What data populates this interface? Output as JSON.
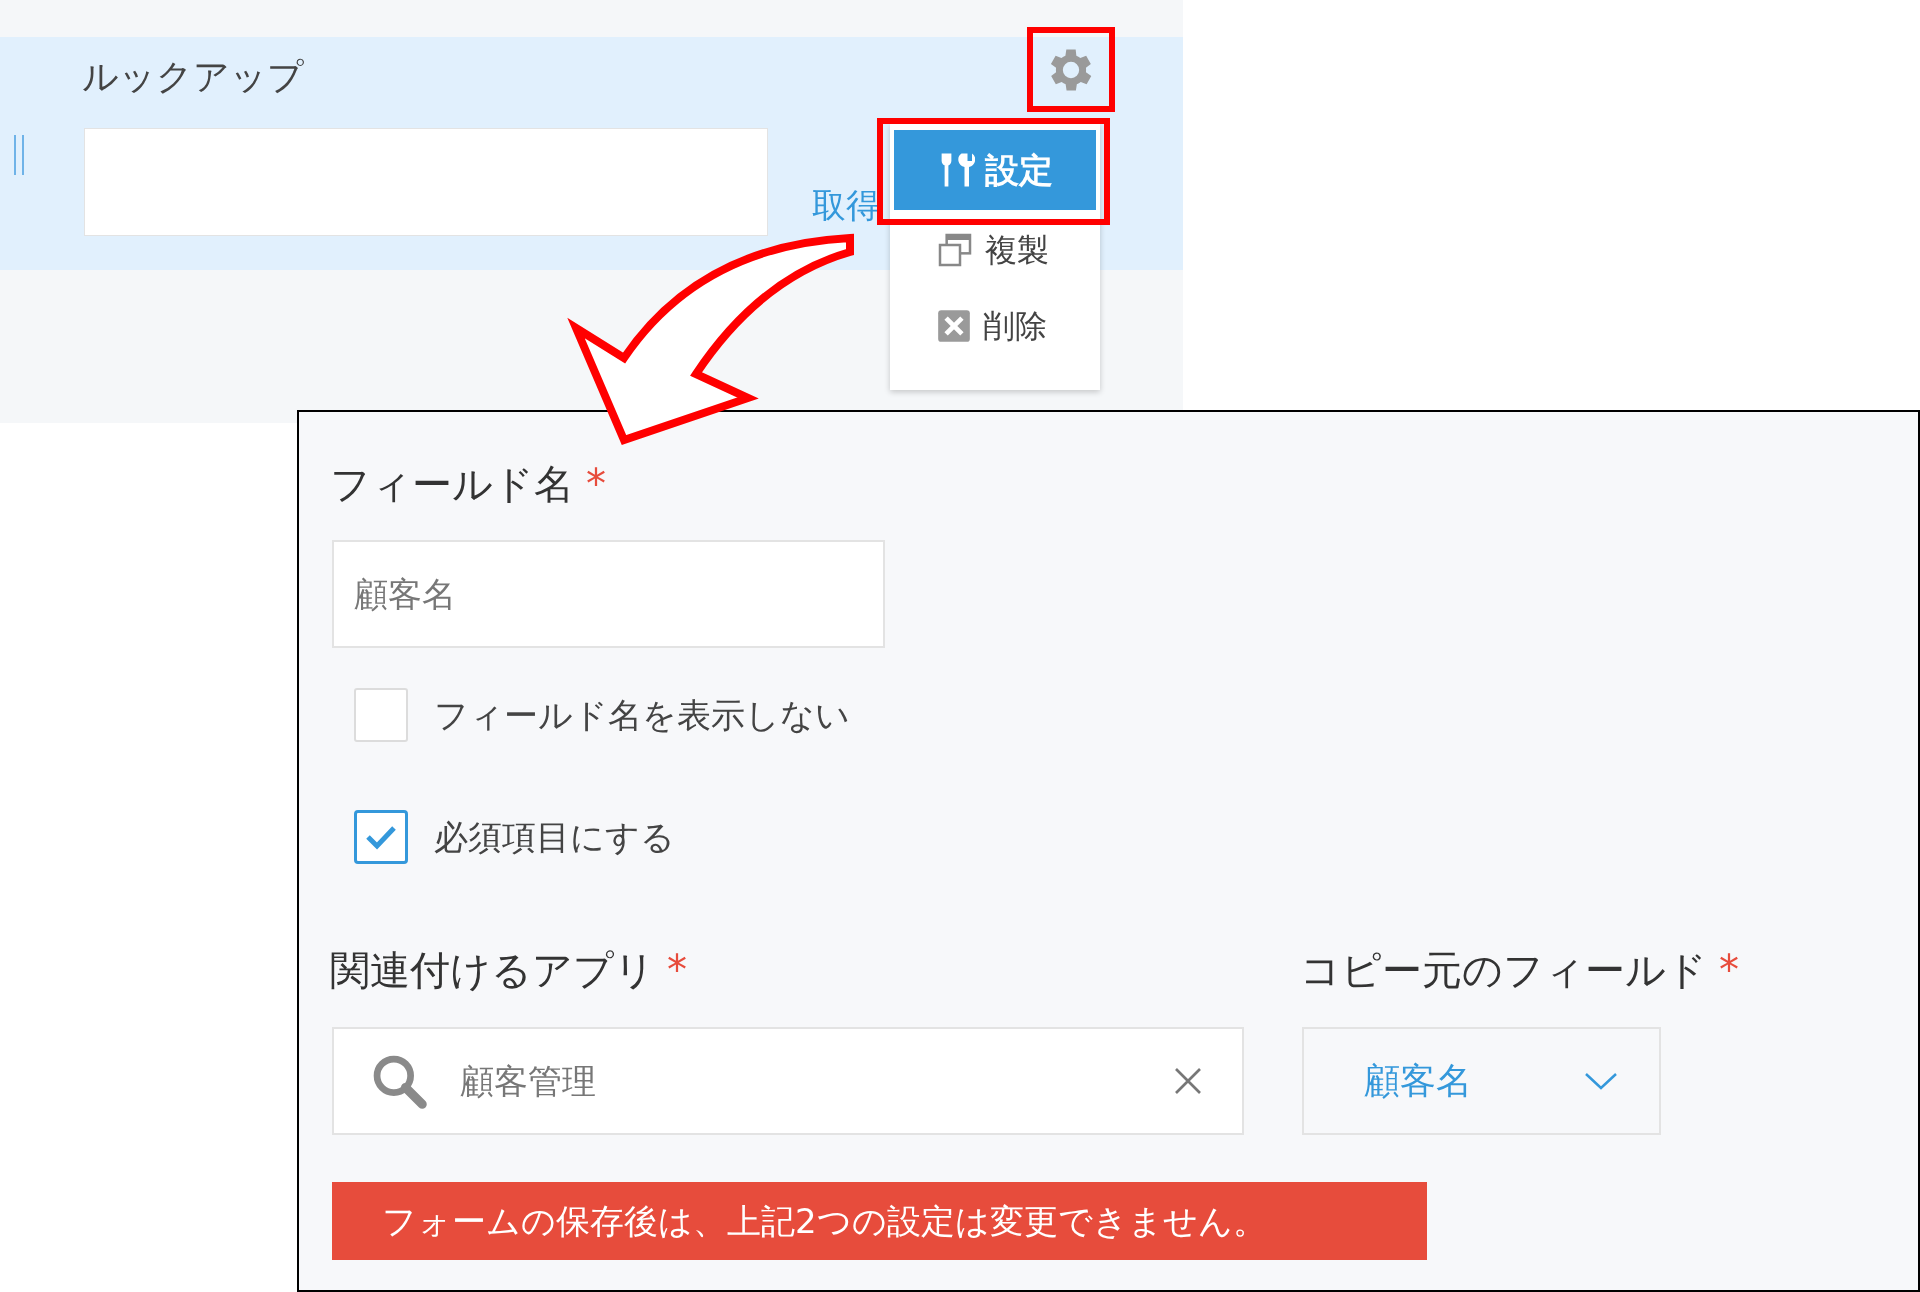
{
  "field_card": {
    "label": "ルックアップ",
    "fetch_link": "取得"
  },
  "field_menu": {
    "items": [
      {
        "kind": "settings",
        "label": "設定",
        "selected": true
      },
      {
        "kind": "duplicate",
        "label": "複製",
        "selected": false
      },
      {
        "kind": "delete",
        "label": "削除",
        "selected": false
      }
    ]
  },
  "settings_panel": {
    "field_name": {
      "label": "フィールド名",
      "required_mark": "*",
      "value": "顧客名"
    },
    "checkboxes": [
      {
        "label": "フィールド名を表示しない",
        "checked": false
      },
      {
        "label": "必須項目にする",
        "checked": true
      }
    ],
    "related_app": {
      "label": "関連付けるアプリ",
      "required_mark": "*",
      "value": "顧客管理"
    },
    "source_field": {
      "label": "コピー元のフィールド",
      "required_mark": "*",
      "value": "顧客名"
    },
    "warning": "フォームの保存後は、上記2つの設定は変更できません。"
  }
}
